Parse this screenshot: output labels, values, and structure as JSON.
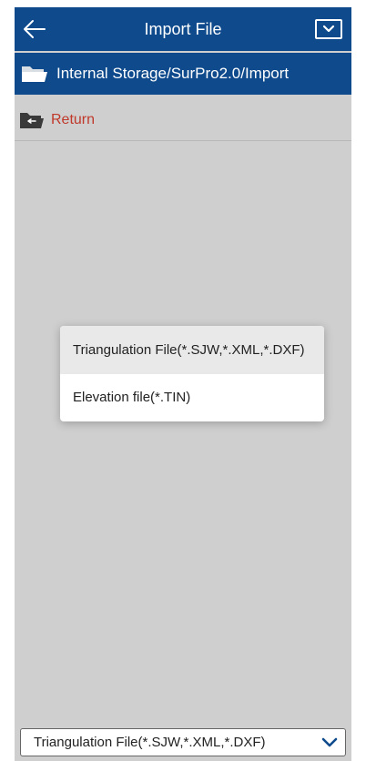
{
  "header": {
    "title": "Import File",
    "back_icon": "arrow-left-icon",
    "menu_icon": "chevron-down-box-icon"
  },
  "pathbar": {
    "path": "Internal Storage/SurPro2.0/Import",
    "icon": "folder-icon"
  },
  "return_row": {
    "label": "Return",
    "icon": "folder-return-icon"
  },
  "popup": {
    "options": [
      {
        "label": "Triangulation File(*.SJW,*.XML,*.DXF)"
      },
      {
        "label": "Elevation file(*.TIN)"
      }
    ]
  },
  "dropdown": {
    "selected": "Triangulation File(*.SJW,*.XML,*.DXF)",
    "icon": "chevron-down-icon"
  },
  "colors": {
    "header_bg": "#0e4a8c",
    "body_bg": "#cfcfcf",
    "return_text": "#c0392b",
    "dropdown_chevron": "#0e4a8c"
  }
}
